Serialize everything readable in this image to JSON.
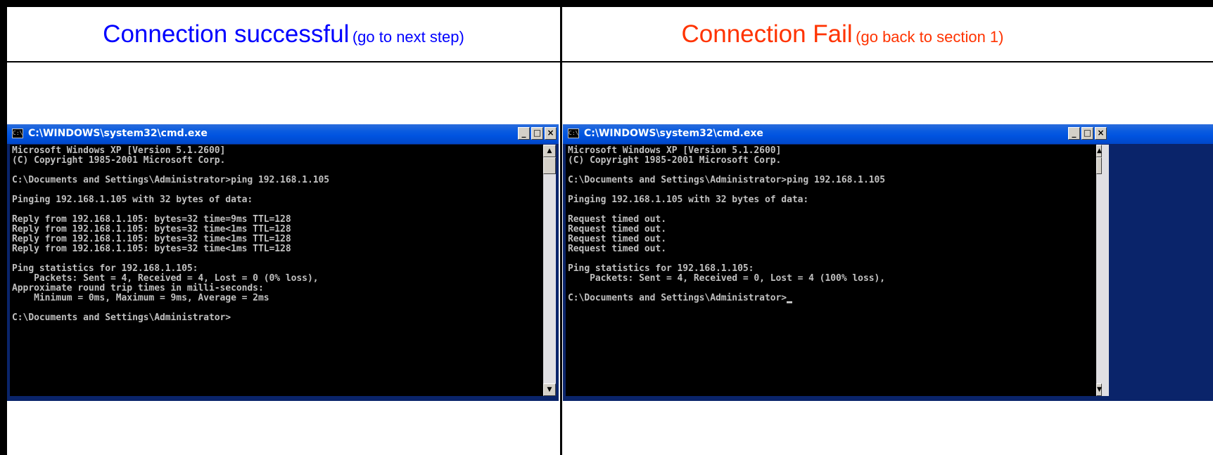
{
  "panels": {
    "left": {
      "heading": "Connection successful",
      "subheading": "(go to next step)",
      "heading_color": "#0000ff"
    },
    "right": {
      "heading": "Connection Fail",
      "subheading": "(go back to section 1)",
      "heading_color": "#ff3300"
    }
  },
  "windows": {
    "left": {
      "title": "C:\\WINDOWS\\system32\\cmd.exe",
      "icon": "cmd-icon",
      "icon_text": "C:\\",
      "buttons": {
        "minimize": "_",
        "maximize": "□",
        "close": "×"
      },
      "lines": [
        "Microsoft Windows XP [Version 5.1.2600]",
        "(C) Copyright 1985-2001 Microsoft Corp.",
        "",
        "C:\\Documents and Settings\\Administrator>ping 192.168.1.105",
        "",
        "Pinging 192.168.1.105 with 32 bytes of data:",
        "",
        "Reply from 192.168.1.105: bytes=32 time=9ms TTL=128",
        "Reply from 192.168.1.105: bytes=32 time<1ms TTL=128",
        "Reply from 192.168.1.105: bytes=32 time<1ms TTL=128",
        "Reply from 192.168.1.105: bytes=32 time<1ms TTL=128",
        "",
        "Ping statistics for 192.168.1.105:",
        "    Packets: Sent = 4, Received = 4, Lost = 0 (0% loss),",
        "Approximate round trip times in milli-seconds:",
        "    Minimum = 0ms, Maximum = 9ms, Average = 2ms",
        "",
        "C:\\Documents and Settings\\Administrator>"
      ]
    },
    "right": {
      "title": "C:\\WINDOWS\\system32\\cmd.exe",
      "icon": "cmd-icon",
      "icon_text": "C:\\",
      "buttons": {
        "minimize": "_",
        "maximize": "□",
        "close": "×"
      },
      "lines": [
        "Microsoft Windows XP [Version 5.1.2600]",
        "(C) Copyright 1985-2001 Microsoft Corp.",
        "",
        "C:\\Documents and Settings\\Administrator>ping 192.168.1.105",
        "",
        "Pinging 192.168.1.105 with 32 bytes of data:",
        "",
        "Request timed out.",
        "Request timed out.",
        "Request timed out.",
        "Request timed out.",
        "",
        "Ping statistics for 192.168.1.105:",
        "    Packets: Sent = 4, Received = 0, Lost = 4 (100% loss),",
        "",
        "C:\\Documents and Settings\\Administrator>"
      ]
    }
  },
  "scrollbar": {
    "up_arrow": "▲",
    "down_arrow": "▼"
  }
}
